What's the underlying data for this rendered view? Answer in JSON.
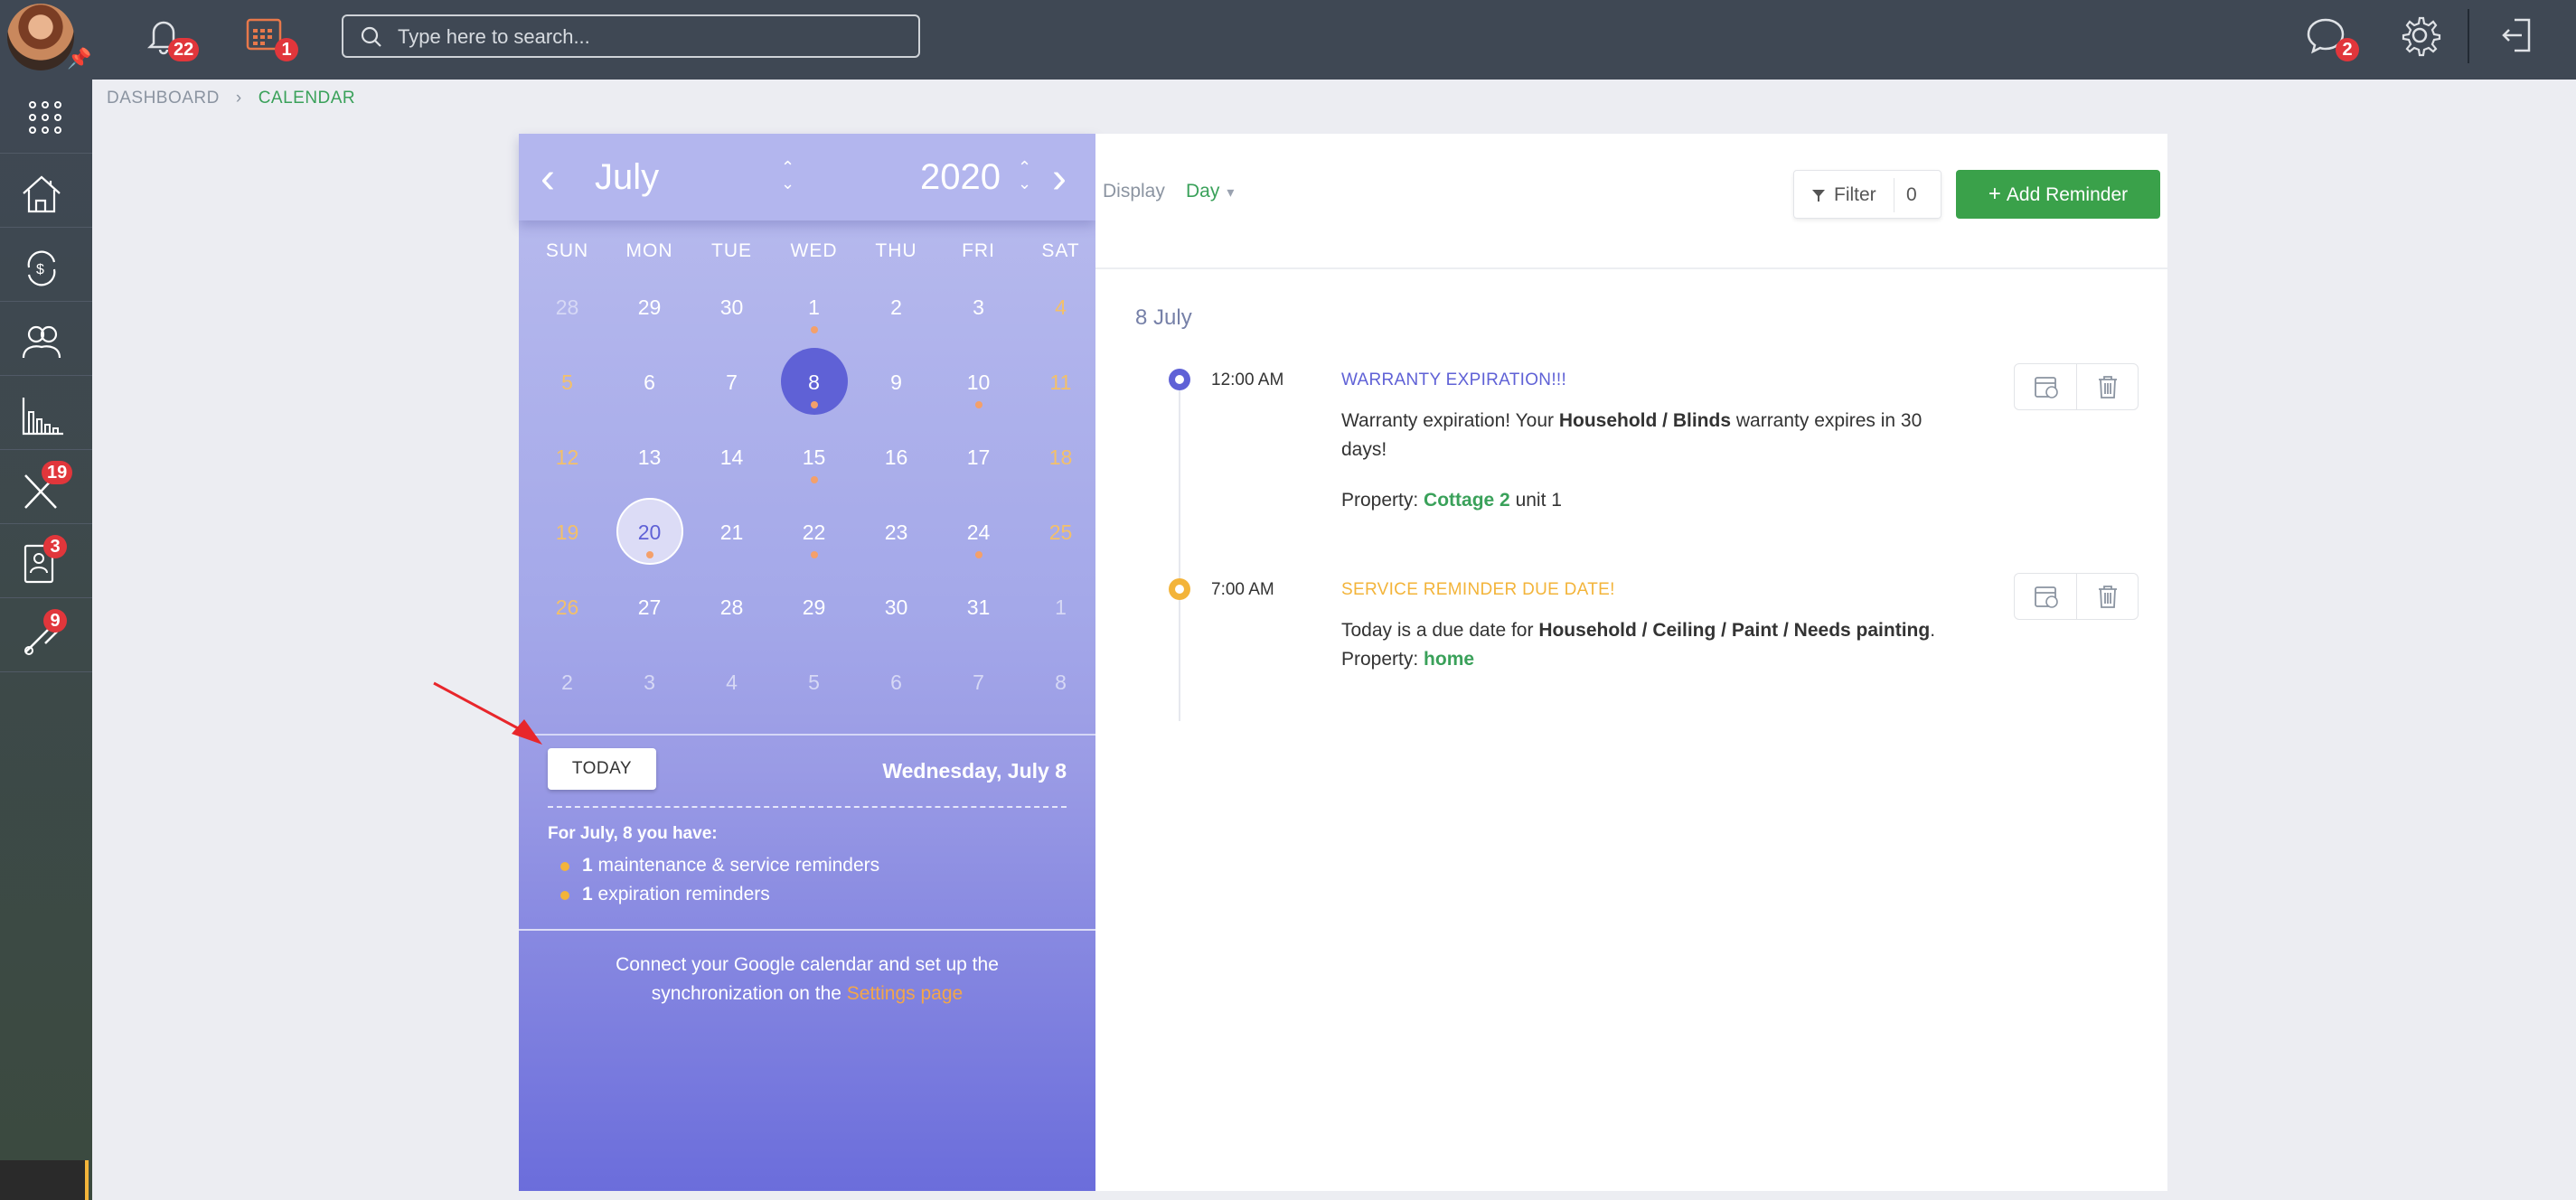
{
  "topbar": {
    "notifications_count": "22",
    "calendar_count": "1",
    "search_placeholder": "Type here to search...",
    "messages_count": "2"
  },
  "sidebar": {
    "items": [
      {
        "icon": "apps-grid-icon"
      },
      {
        "icon": "property-icon"
      },
      {
        "icon": "finance-icon"
      },
      {
        "icon": "contacts-icon"
      },
      {
        "icon": "reports-icon"
      },
      {
        "icon": "maintenance-tools-icon",
        "badge": "19"
      },
      {
        "icon": "tenant-card-icon",
        "badge": "3"
      },
      {
        "icon": "service-icon",
        "badge": "9"
      }
    ]
  },
  "breadcrumb": {
    "root": "DASHBOARD",
    "current": "CALENDAR"
  },
  "calendar": {
    "month": "July",
    "year": "2020",
    "weekdays": [
      "SUN",
      "MON",
      "TUE",
      "WED",
      "THU",
      "FRI",
      "SAT"
    ],
    "weeks": [
      [
        "28",
        "29",
        "30",
        "1",
        "2",
        "3",
        "4"
      ],
      [
        "5",
        "6",
        "7",
        "8",
        "9",
        "10",
        "11"
      ],
      [
        "12",
        "13",
        "14",
        "15",
        "16",
        "17",
        "18"
      ],
      [
        "19",
        "20",
        "21",
        "22",
        "23",
        "24",
        "25"
      ],
      [
        "26",
        "27",
        "28",
        "29",
        "30",
        "31",
        "1"
      ],
      [
        "2",
        "3",
        "4",
        "5",
        "6",
        "7",
        "8"
      ]
    ],
    "today_button": "TODAY",
    "current_date": "Wednesday, July 8",
    "summary_title": "For July, 8 you have:",
    "summary": [
      {
        "count": "1",
        "label": " maintenance & service reminders"
      },
      {
        "count": "1",
        "label": " expiration reminders"
      }
    ],
    "google_text": "Connect your Google calendar and set up the synchronization on the ",
    "google_link": "Settings page"
  },
  "toolbar": {
    "display_label": "Display",
    "display_value": "Day",
    "filter_label": "Filter",
    "filter_count": "0",
    "add_label": "Add Reminder"
  },
  "agenda": {
    "date": "8 July",
    "events": [
      {
        "time": "12:00 AM",
        "title": "WARRANTY EXPIRATION!!!",
        "color": "#5f61d6",
        "body_pre": "Warranty expiration! Your ",
        "body_bold": "Household / Blinds",
        "body_post": " warranty expires in 30 days!",
        "property_label": "Property: ",
        "property_link": "Cottage 2",
        "property_post": " unit 1"
      },
      {
        "time": "7:00 AM",
        "title": "SERVICE REMINDER DUE DATE!",
        "color": "#f3b43a",
        "body_pre": "Today is a due date for ",
        "body_bold": "Household / Ceiling / Paint / Needs painting",
        "body_post": ".",
        "property_label": "Property: ",
        "property_link": "home"
      }
    ]
  }
}
